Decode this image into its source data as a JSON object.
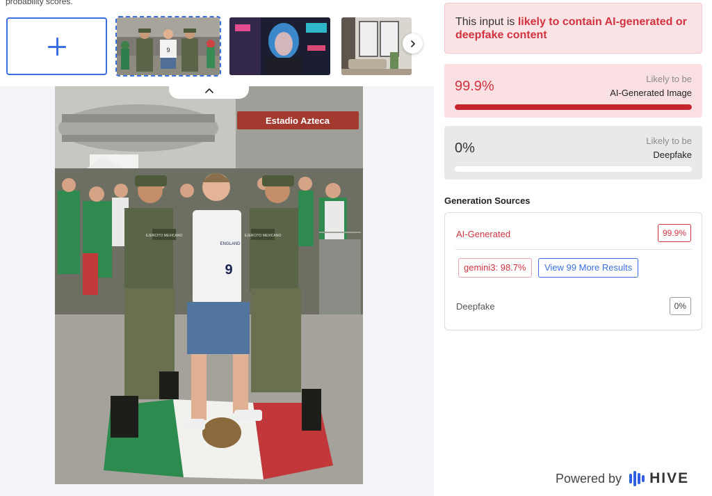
{
  "caption": "probability scores.",
  "gallery": {
    "upload_icon": "plus-icon",
    "next_icon": "chevron-right-icon",
    "collapse_icon": "chevron-up-icon"
  },
  "main_image": {
    "sign_text": "Estadio Azteca",
    "shirt_text": "ENGLAND",
    "shirt_number": "9",
    "patch_left": "EJERCITO MEXICANO",
    "patch_right": "EJERCITO MEXICANO"
  },
  "verdict": {
    "prefix": "This input is ",
    "highlight": "likely to contain AI-generated or deepfake content"
  },
  "scores": {
    "ai": {
      "value": "99.9%",
      "sub": "Likely to be",
      "label": "AI-Generated Image",
      "fraction": 0.999
    },
    "deepfake": {
      "value": "0%",
      "sub": "Likely to be",
      "label": "Deepfake",
      "fraction": 0
    }
  },
  "sources": {
    "heading": "Generation Sources",
    "ai_label": "AI-Generated",
    "ai_score": "99.9%",
    "model_chip": "gemini3: 98.7%",
    "more_button": "View 99 More Results",
    "deepfake_label": "Deepfake",
    "deepfake_score": "0%"
  },
  "footer": {
    "powered": "Powered by",
    "brand": "HIVE",
    "logo_icon": "hive-logo-icon"
  },
  "colors": {
    "accent_blue": "#3b6fe0",
    "alert_red": "#d1333f",
    "bar_red": "#c6252e"
  }
}
